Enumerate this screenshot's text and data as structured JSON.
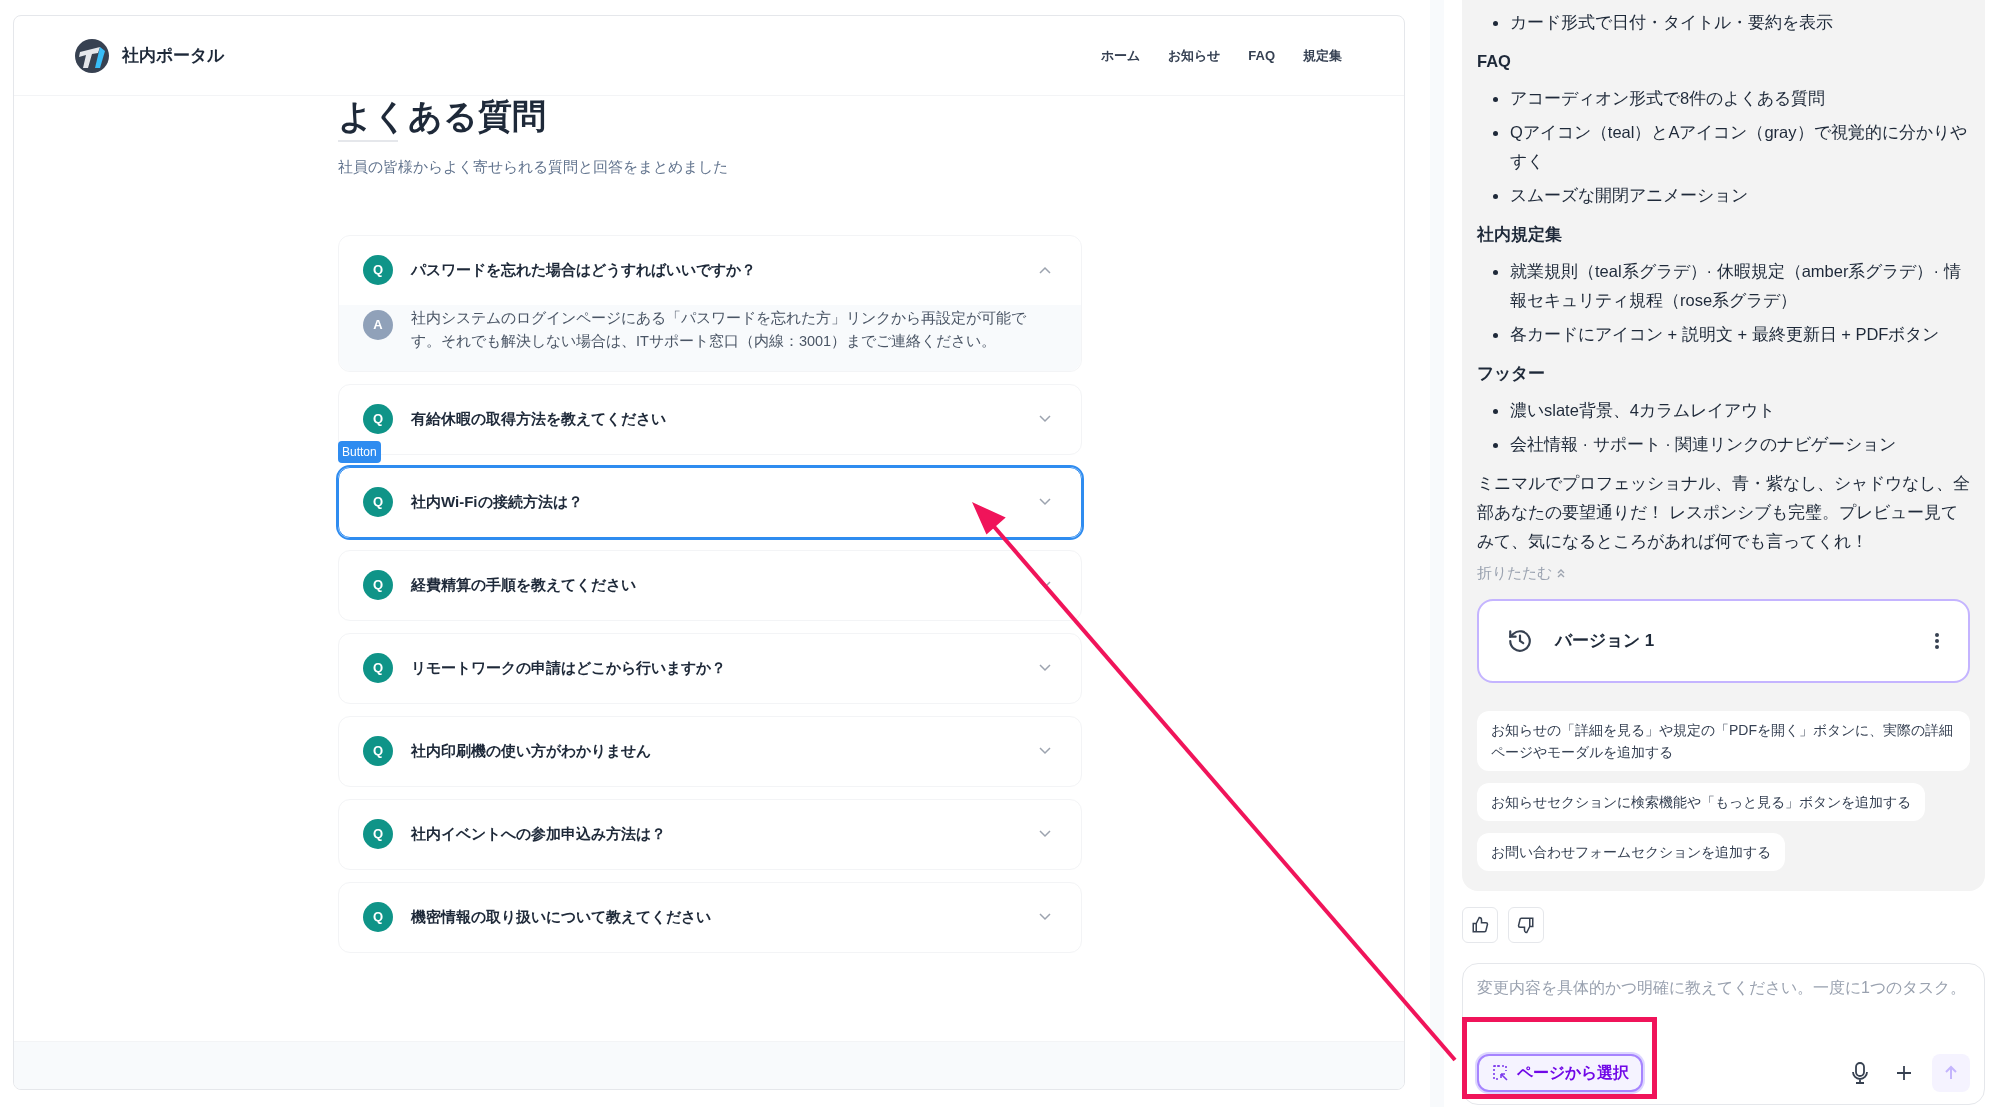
{
  "preview": {
    "brand": "社内ポータル",
    "nav": [
      {
        "label": "ホーム"
      },
      {
        "label": "お知らせ"
      },
      {
        "label": "FAQ"
      },
      {
        "label": "規定集"
      }
    ],
    "title": "よくある質問",
    "subtitle": "社員の皆様からよく寄せられる質問と回答をまとめました",
    "selection_label": "Button",
    "faq": [
      {
        "badge": "Q",
        "question": "パスワードを忘れた場合はどうすればいいですか？",
        "expanded": true,
        "selected": false,
        "answer_badge": "A",
        "answer": "社内システムのログインページにある「パスワードを忘れた方」リンクから再設定が可能です。それでも解決しない場合は、ITサポート窓口（内線：3001）までご連絡ください。"
      },
      {
        "badge": "Q",
        "question": "有給休暇の取得方法を教えてください",
        "expanded": false,
        "selected": false
      },
      {
        "badge": "Q",
        "question": "社内Wi-Fiの接続方法は？",
        "expanded": false,
        "selected": true
      },
      {
        "badge": "Q",
        "question": "経費精算の手順を教えてください",
        "expanded": false,
        "selected": false
      },
      {
        "badge": "Q",
        "question": "リモートワークの申請はどこから行いますか？",
        "expanded": false,
        "selected": false
      },
      {
        "badge": "Q",
        "question": "社内印刷機の使い方がわかりません",
        "expanded": false,
        "selected": false
      },
      {
        "badge": "Q",
        "question": "社内イベントへの参加申込み方法は？",
        "expanded": false,
        "selected": false
      },
      {
        "badge": "Q",
        "question": "機密情報の取り扱いについて教えてください",
        "expanded": false,
        "selected": false
      }
    ]
  },
  "chat": {
    "message": [
      {
        "kind": "bullets",
        "items": [
          "カード形式で日付・タイトル・要約を表示"
        ]
      },
      {
        "kind": "heading",
        "text": "FAQ"
      },
      {
        "kind": "bullets",
        "items": [
          "アコーディオン形式で8件のよくある質問",
          "Qアイコン（teal）とAアイコン（gray）で視覚的に分かりやすく",
          "スムーズな開閉アニメーション"
        ]
      },
      {
        "kind": "heading",
        "text": "社内規定集"
      },
      {
        "kind": "bullets",
        "items": [
          "就業規則（teal系グラデ）· 休暇規定（amber系グラデ）· 情報セキュリティ規程（rose系グラデ）",
          "各カードにアイコン + 説明文 + 最終更新日 + PDFボタン"
        ]
      },
      {
        "kind": "heading",
        "text": "フッター"
      },
      {
        "kind": "bullets",
        "items": [
          "濃いslate背景、4カラムレイアウト",
          "会社情報 · サポート · 関連リンクのナビゲーション"
        ]
      },
      {
        "kind": "paragraph",
        "text": "ミニマルでプロフェッショナル、青・紫なし、シャドウなし、全部あなたの要望通りだ！ レスポンシブも完璧。プレビュー見てみて、気になるところがあれば何でも言ってくれ！"
      }
    ],
    "collapse": "折りたたむ",
    "version": "バージョン 1",
    "suggestions": [
      "お知らせの「詳細を見る」や規定の「PDFを開く」ボタンに、実際の詳細ページやモーダルを追加する",
      "お知らせセクションに検索機能や「もっと見る」ボタンを追加する",
      "お問い合わせフォームセクションを追加する"
    ],
    "input": {
      "placeholder": "変更内容を具体的かつ明確に教えてください。一度に1つのタスク。"
    },
    "select_button": "ページから選択"
  }
}
